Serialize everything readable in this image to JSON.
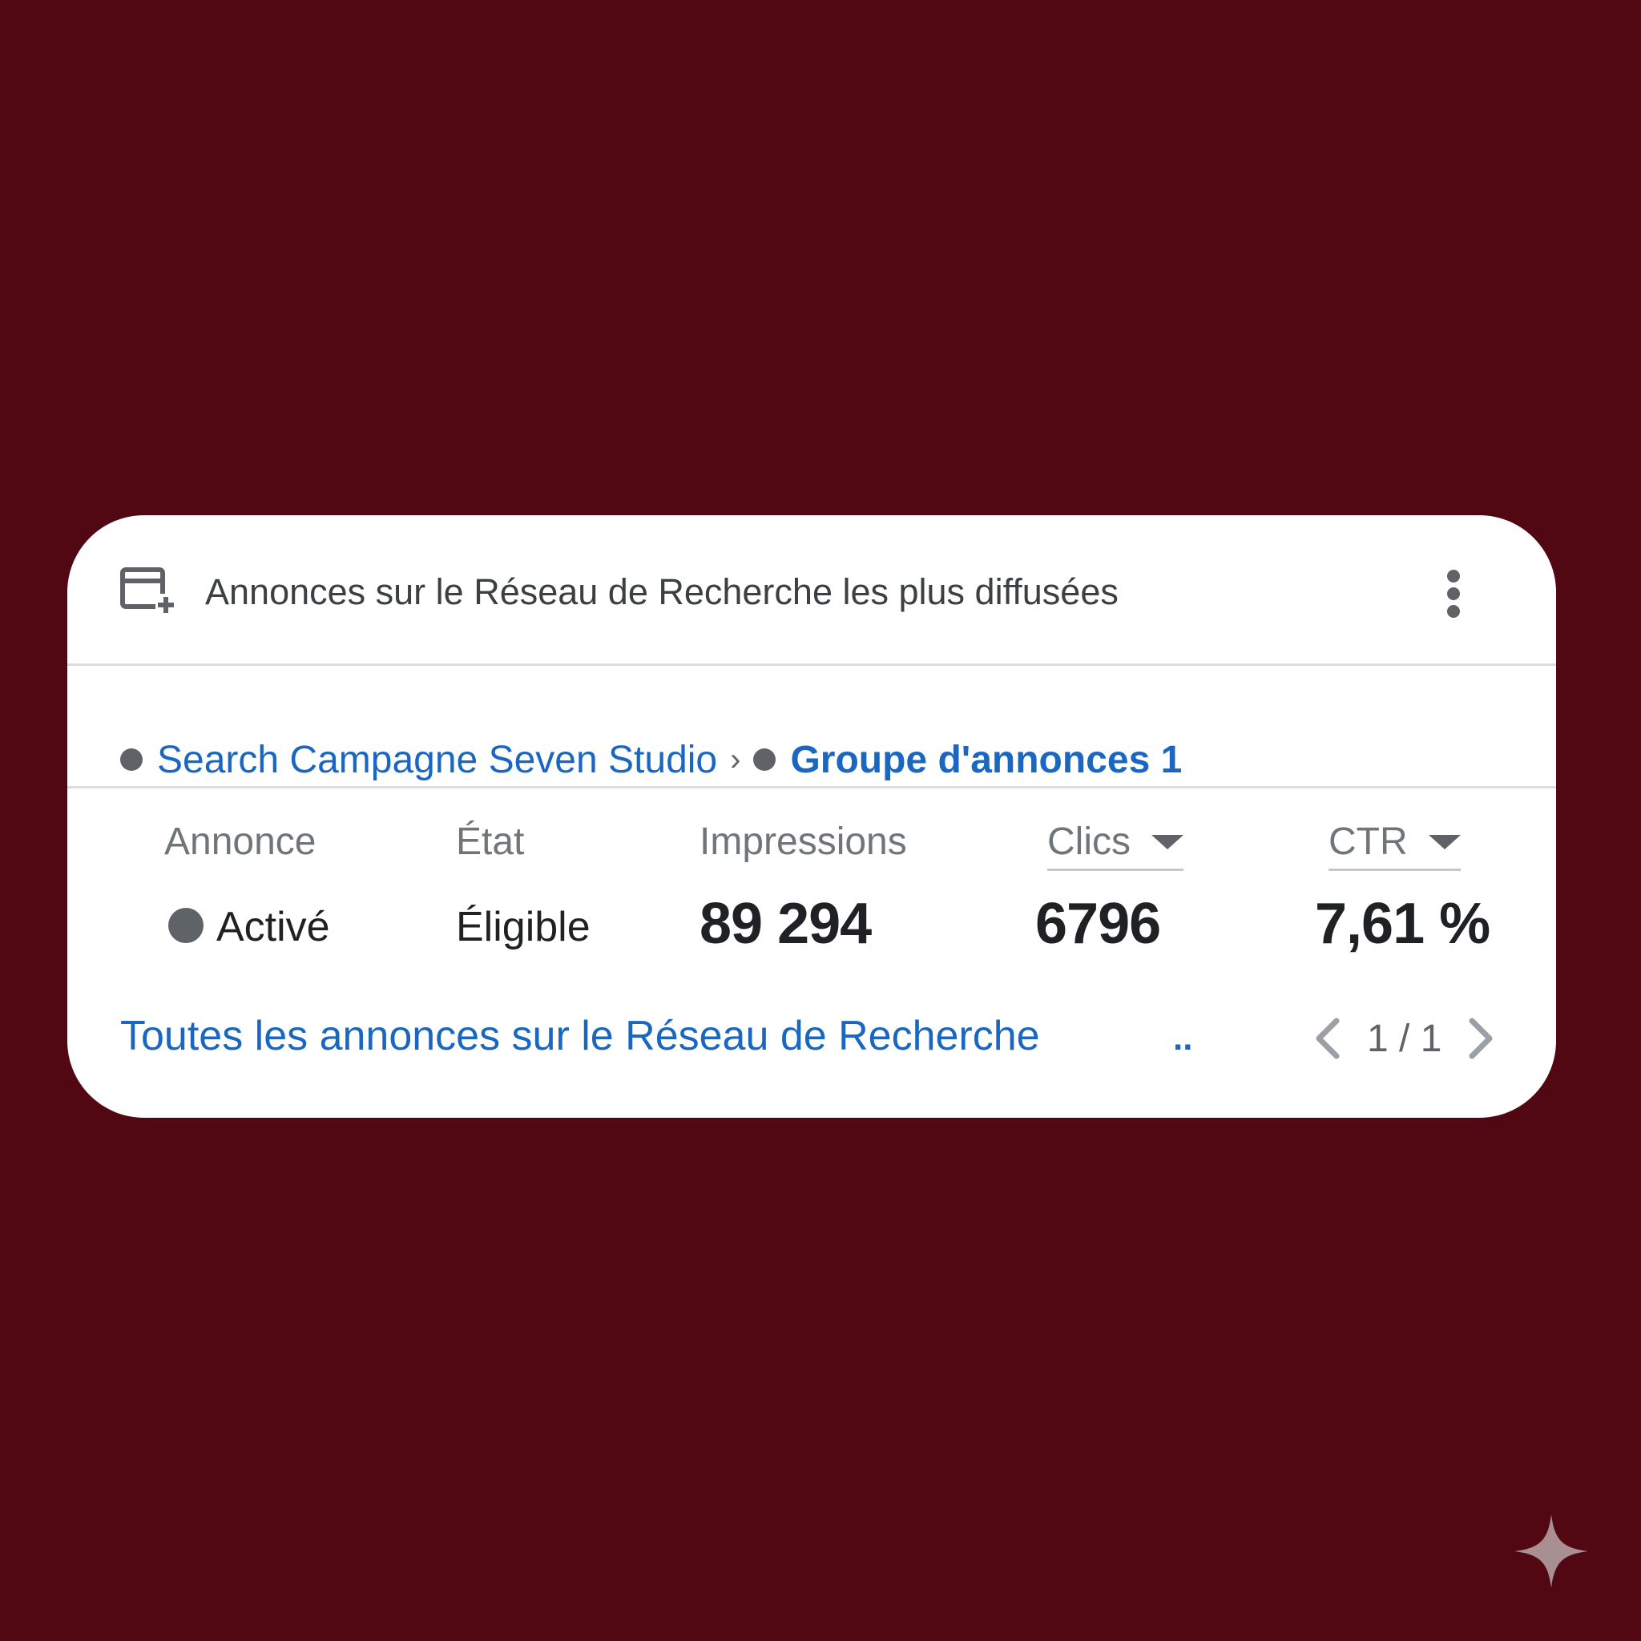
{
  "card": {
    "title": "Annonces sur le Réseau de Recherche les plus diffusées",
    "icon": "ad-add-icon",
    "menu_icon": "more-vert-icon"
  },
  "breadcrumb": {
    "campaign": "Search Campagne Seven Studio",
    "separator": "›",
    "ad_group": "Groupe d'annonces 1"
  },
  "table": {
    "columns": {
      "ad": "Annonce",
      "status": "État",
      "impressions": "Impressions",
      "clicks": "Clics",
      "ctr": "CTR"
    },
    "row": {
      "ad": "Activé",
      "status": "Éligible",
      "impressions": "89 294",
      "clicks": "6796",
      "ctr": "7,61 %"
    }
  },
  "footer": {
    "link": "Toutes les annonces sur le Réseau de Recherche",
    "overflow": "..",
    "pagination": "1 / 1"
  },
  "colors": {
    "background": "#520812",
    "link": "#1a67c2",
    "status_dot": "#5f6368"
  }
}
